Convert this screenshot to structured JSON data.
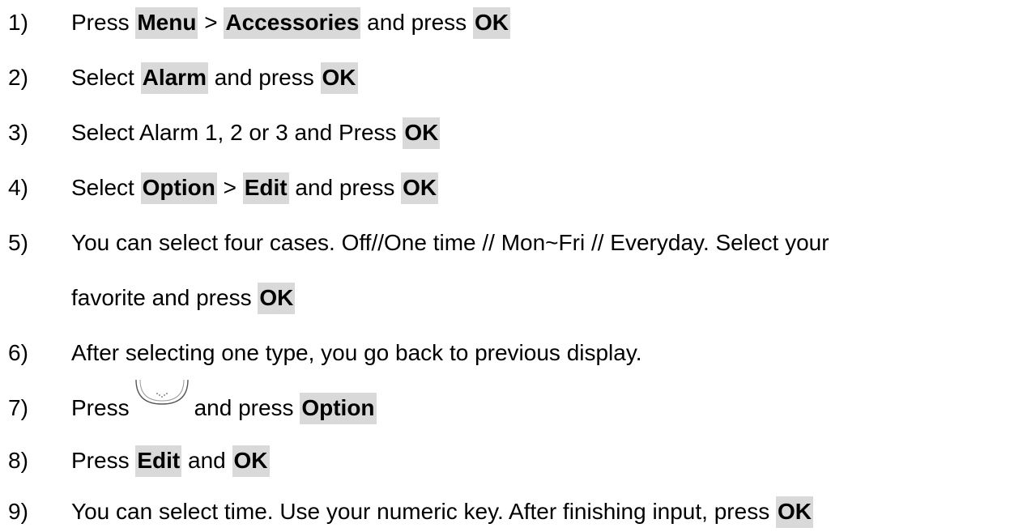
{
  "steps": [
    {
      "n": "1)",
      "parts": [
        "Press ",
        "Menu",
        " > ",
        "Accessories",
        " and press ",
        "OK"
      ]
    },
    {
      "n": "2)",
      "parts": [
        "Select ",
        "Alarm",
        " and press ",
        "OK"
      ]
    },
    {
      "n": "3)",
      "parts": [
        "Select Alarm 1, 2 or 3 and Press ",
        "OK"
      ]
    },
    {
      "n": "4)",
      "parts": [
        "Select ",
        "Option",
        " > ",
        "Edit",
        " and press ",
        "OK"
      ]
    },
    {
      "n": "5)",
      "parts": [
        "You can select four cases. Off//One time // Mon~Fri // Everyday. Select your"
      ]
    },
    {
      "parts": [
        "favorite and press ",
        "OK"
      ]
    },
    {
      "n": "6)",
      "parts": [
        "After selecting one type, you go back to previous display."
      ]
    },
    {
      "n": "7)",
      "parts": [
        "Press",
        "and press ",
        "Option"
      ]
    },
    {
      "n": "8)",
      "parts": [
        "Press ",
        "Edit",
        " and ",
        "OK"
      ]
    },
    {
      "n": "9)",
      "parts": [
        "You can select time. Use your numeric key. After finishing input, press ",
        "OK"
      ]
    }
  ],
  "nav_key_icon": "down-navigation-key-icon",
  "colors": {
    "key_highlight": "#d9d9d9",
    "text": "#000000"
  }
}
